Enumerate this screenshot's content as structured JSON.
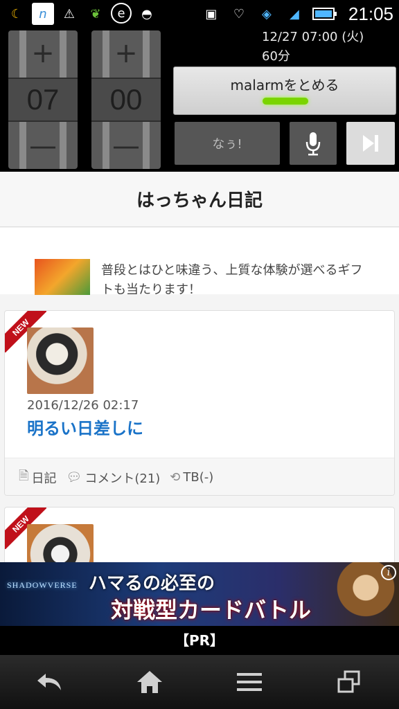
{
  "status_bar": {
    "time": "21:05",
    "left_icons": [
      "moon-app-icon",
      "note-app-icon",
      "warning-icon",
      "leaf-icon",
      "e-app-icon",
      "android-icon"
    ],
    "right_icons": [
      "voicemail-icon",
      "heart-icon",
      "wifi-icon",
      "signal-icon",
      "battery-icon"
    ]
  },
  "alarm_widget": {
    "hour": "07",
    "minute": "00",
    "plus_label": "+",
    "minus_label": "—",
    "info_line1": "12/27 07:00 (火)",
    "info_line2": "60分",
    "stop_label": "malarmをとめる",
    "nau_label": "なぅ!",
    "accent_color": "#7ad400"
  },
  "blog": {
    "title": "はっちゃん日記",
    "promo_text": "普段とはひと味違う、上質な体験が選べるギフトも当たります！",
    "new_label": "NEW",
    "posts": [
      {
        "date": "2016/12/26 02:17",
        "title": "明るい日差しに",
        "category": "日記",
        "comments": "コメント(21)",
        "tb": "TB(-)"
      }
    ]
  },
  "ad": {
    "logo": "SHADOWVERSE",
    "line1": "ハマるの必至の",
    "line2": "対戦型カードバトル",
    "info": "i"
  },
  "pr_label": "【PR】",
  "nav": {
    "back": "↩",
    "home": "⌂",
    "menu": "☰",
    "recent": "❐"
  }
}
